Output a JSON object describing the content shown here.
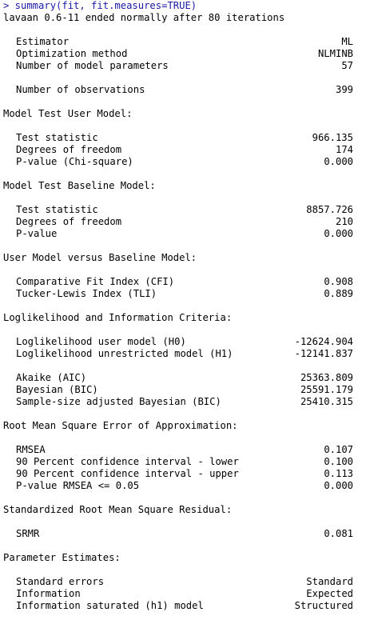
{
  "command": "> summary(fit, fit.measures=TRUE)",
  "header": "lavaan 0.6-11 ended normally after 80 iterations",
  "blocks": {
    "estimator": [
      {
        "label": "Estimator",
        "value": "ML"
      },
      {
        "label": "Optimization method",
        "value": "NLMINB"
      },
      {
        "label": "Number of model parameters",
        "value": "57"
      }
    ],
    "observations": [
      {
        "label": "Number of observations",
        "value": "399"
      }
    ],
    "user_model": {
      "title": "Model Test User Model:",
      "rows": [
        {
          "label": "Test statistic",
          "value": "966.135"
        },
        {
          "label": "Degrees of freedom",
          "value": "174"
        },
        {
          "label": "P-value (Chi-square)",
          "value": "0.000"
        }
      ]
    },
    "baseline_model": {
      "title": "Model Test Baseline Model:",
      "rows": [
        {
          "label": "Test statistic",
          "value": "8857.726"
        },
        {
          "label": "Degrees of freedom",
          "value": "210"
        },
        {
          "label": "P-value",
          "value": "0.000"
        }
      ]
    },
    "user_vs_baseline": {
      "title": "User Model versus Baseline Model:",
      "rows": [
        {
          "label": "Comparative Fit Index (CFI)",
          "value": "0.908"
        },
        {
          "label": "Tucker-Lewis Index (TLI)",
          "value": "0.889"
        }
      ]
    },
    "loglik": {
      "title": "Loglikelihood and Information Criteria:",
      "rows": [
        {
          "label": "Loglikelihood user model (H0)",
          "value": "-12624.904"
        },
        {
          "label": "Loglikelihood unrestricted model (H1)",
          "value": "-12141.837"
        }
      ],
      "rows2": [
        {
          "label": "Akaike (AIC)",
          "value": "25363.809"
        },
        {
          "label": "Bayesian (BIC)",
          "value": "25591.179"
        },
        {
          "label": "Sample-size adjusted Bayesian (BIC)",
          "value": "25410.315"
        }
      ]
    },
    "rmsea": {
      "title": "Root Mean Square Error of Approximation:",
      "rows": [
        {
          "label": "RMSEA",
          "value": "0.107"
        },
        {
          "label": "90 Percent confidence interval - lower",
          "value": "0.100"
        },
        {
          "label": "90 Percent confidence interval - upper",
          "value": "0.113"
        },
        {
          "label": "P-value RMSEA <= 0.05",
          "value": "0.000"
        }
      ]
    },
    "srmr": {
      "title": "Standardized Root Mean Square Residual:",
      "rows": [
        {
          "label": "SRMR",
          "value": "0.081"
        }
      ]
    },
    "parameter_estimates": {
      "title": "Parameter Estimates:",
      "rows": [
        {
          "label": "Standard errors",
          "value": "Standard"
        },
        {
          "label": "Information",
          "value": "Expected"
        },
        {
          "label": "Information saturated (h1) model",
          "value": "Structured"
        }
      ]
    }
  },
  "colors": {
    "command": "#1a1aa6",
    "text": "#000000",
    "background": "#ffffff"
  }
}
